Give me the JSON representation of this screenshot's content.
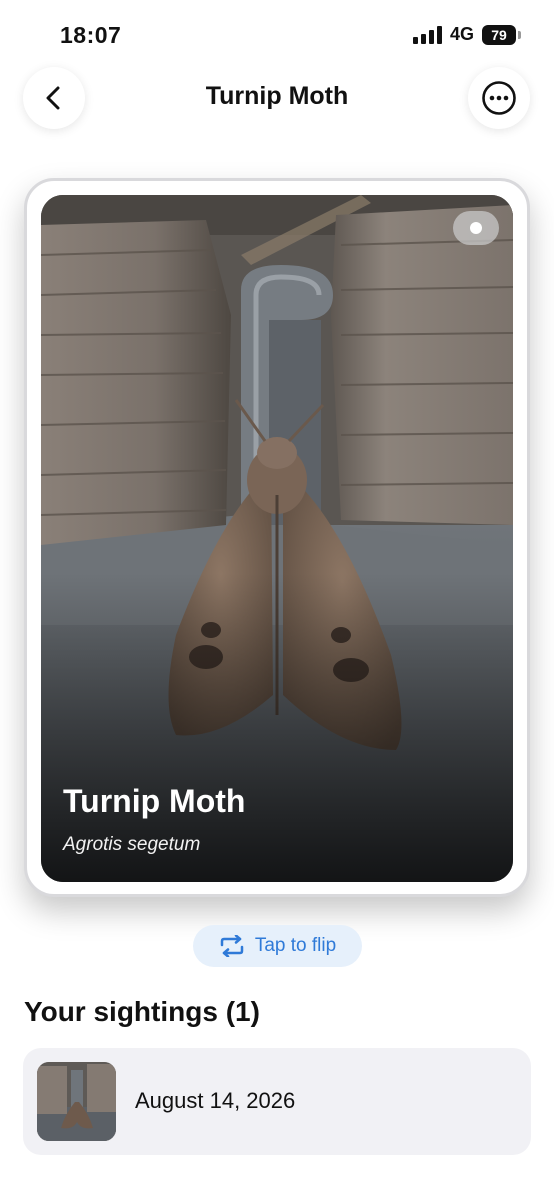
{
  "status": {
    "time": "18:07",
    "network": "4G",
    "battery": "79"
  },
  "nav": {
    "title": "Turnip Moth"
  },
  "card": {
    "common_name": "Turnip Moth",
    "scientific_name": "Agrotis segetum"
  },
  "flip": {
    "label": "Tap to flip"
  },
  "sightings": {
    "title": "Your sightings (1)",
    "items": [
      {
        "date": "August 14, 2026"
      }
    ]
  },
  "colors": {
    "accent": "#2f7ad8",
    "flip_bg": "#e6f0fb",
    "row_bg": "#f1f1f5"
  },
  "icons": {
    "back": "chevron-left-icon",
    "more": "ellipsis-circle-icon",
    "flip": "flip-arrows-icon"
  }
}
